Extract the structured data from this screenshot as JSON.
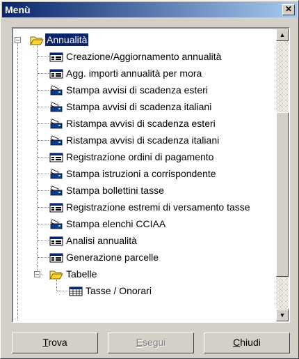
{
  "window": {
    "title": "Menù"
  },
  "tree": {
    "root_label": "Annualità",
    "items": [
      {
        "label": "Creazione/Aggiornamento annualità",
        "icon": "form-icon"
      },
      {
        "label": "Agg. importi annualità per mora",
        "icon": "form-icon"
      },
      {
        "label": "Stampa avvisi di scadenza esteri",
        "icon": "printer-icon"
      },
      {
        "label": "Stampa avvisi di scadenza italiani",
        "icon": "printer-icon"
      },
      {
        "label": "Ristampa avvisi di scadenza esteri",
        "icon": "printer-icon"
      },
      {
        "label": "Ristampa avvisi di scadenza italiani",
        "icon": "printer-icon"
      },
      {
        "label": "Registrazione ordini di pagamento",
        "icon": "form-icon"
      },
      {
        "label": "Stampa istruzioni a corrispondente",
        "icon": "printer-icon"
      },
      {
        "label": "Stampa bollettini tasse",
        "icon": "printer-icon"
      },
      {
        "label": "Registrazione estremi di versamento tasse",
        "icon": "form-icon"
      },
      {
        "label": "Stampa elenchi CCIAA",
        "icon": "printer-icon"
      },
      {
        "label": "Analisi annualità",
        "icon": "form-icon"
      },
      {
        "label": "Generazione parcelle",
        "icon": "form-icon"
      }
    ],
    "subfolder_label": "Tabelle",
    "subfolder_items": [
      {
        "label": "Tasse / Onorari",
        "icon": "table-icon"
      }
    ]
  },
  "buttons": {
    "trova": {
      "label_accel": "T",
      "label_rest": "rova"
    },
    "esegui": {
      "label_accel": "E",
      "label_rest": "segui"
    },
    "chiudi": {
      "label_accel": "C",
      "label_rest": "hiudi"
    }
  },
  "colors": {
    "titlebar": "#0a246a",
    "selection": "#0a246a",
    "face": "#d4d0c8"
  }
}
